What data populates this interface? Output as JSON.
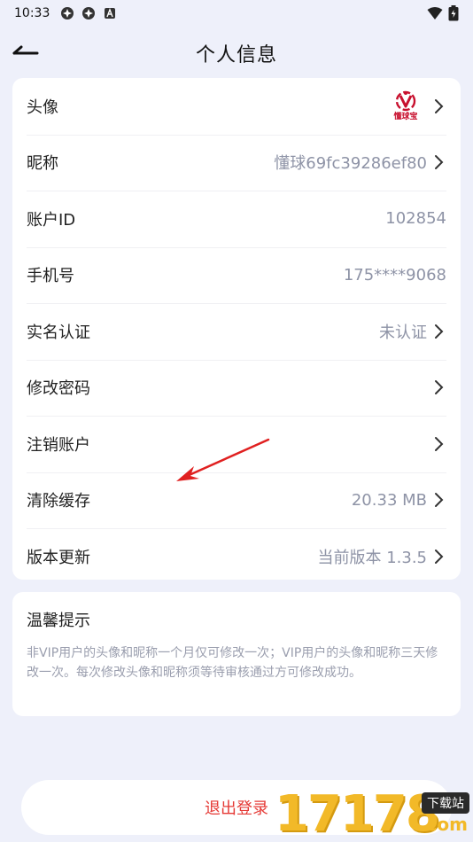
{
  "status_bar": {
    "time": "10:33"
  },
  "header": {
    "title": "个人信息"
  },
  "rows": [
    {
      "label": "头像",
      "value": "",
      "chevron": true
    },
    {
      "label": "昵称",
      "value": "懂球69fc39286ef80",
      "chevron": true
    },
    {
      "label": "账户ID",
      "value": "102854",
      "chevron": false
    },
    {
      "label": "手机号",
      "value": "175****9068",
      "chevron": false
    },
    {
      "label": "实名认证",
      "value": "未认证",
      "chevron": true
    },
    {
      "label": "修改密码",
      "value": "",
      "chevron": true
    },
    {
      "label": "注销账户",
      "value": "",
      "chevron": true
    },
    {
      "label": "清除缓存",
      "value": "20.33 MB",
      "chevron": true
    },
    {
      "label": "版本更新",
      "value": "当前版本 1.3.5",
      "chevron": true
    }
  ],
  "avatar": {
    "logo_text": "懂球宝"
  },
  "tip": {
    "title": "温馨提示",
    "body": "非VIP用户的头像和昵称一个月仅可修改一次；VIP用户的头像和昵称三天修改一次。每次修改头像和昵称须等待审核通过方可修改成功。"
  },
  "logout": {
    "label": "退出登录"
  },
  "watermark": {
    "digits": "17178",
    "badge": "下载站",
    "suffix": ".com"
  },
  "colors": {
    "background": "#EEF0FA",
    "logout": "#E53935",
    "value_text": "#8E93A6",
    "annotation_arrow": "#E02020"
  }
}
